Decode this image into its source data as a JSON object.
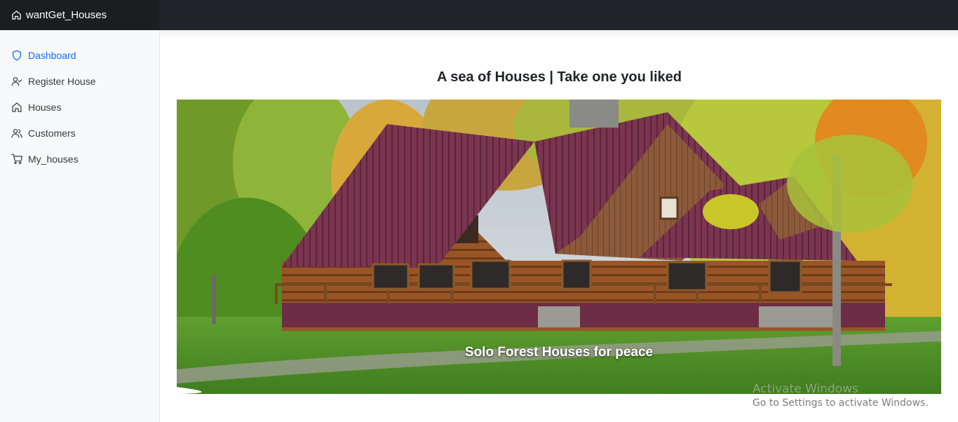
{
  "app": {
    "brand": "wantGet_Houses"
  },
  "sidebar": {
    "items": [
      {
        "label": "Dashboard",
        "icon": "shield-icon",
        "active": true
      },
      {
        "label": "Register House",
        "icon": "user-check-icon",
        "active": false
      },
      {
        "label": "Houses",
        "icon": "home-icon",
        "active": false
      },
      {
        "label": "Customers",
        "icon": "users-icon",
        "active": false
      },
      {
        "label": "My_houses",
        "icon": "cart-icon",
        "active": false
      }
    ]
  },
  "main": {
    "heading": "A sea of Houses | Take one you liked",
    "hero": {
      "caption": "Solo Forest Houses for peace"
    }
  },
  "watermark": {
    "title": "Activate Windows",
    "subtitle": "Go to Settings to activate Windows."
  },
  "colors": {
    "topbar": "#212529",
    "sidebar": "#f8f9fa",
    "accent": "#0d6efd"
  }
}
